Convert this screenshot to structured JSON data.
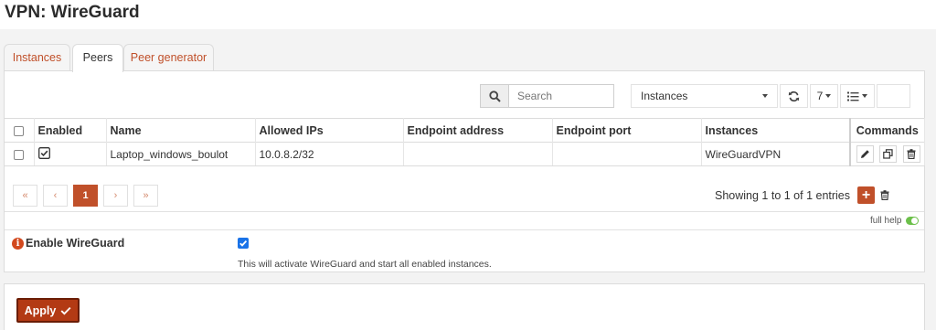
{
  "page": {
    "title": "VPN: WireGuard"
  },
  "tabs": [
    {
      "label": "Instances",
      "active": false
    },
    {
      "label": "Peers",
      "active": true
    },
    {
      "label": "Peer generator",
      "active": false
    }
  ],
  "toolbar": {
    "search_placeholder": "Search",
    "instances_filter": "Instances",
    "page_size": "7"
  },
  "grid": {
    "columns": {
      "enabled": "Enabled",
      "name": "Name",
      "allowed_ips": "Allowed IPs",
      "endpoint_address": "Endpoint address",
      "endpoint_port": "Endpoint port",
      "instances": "Instances",
      "commands": "Commands"
    },
    "rows": [
      {
        "enabled": true,
        "name": "Laptop_windows_boulot",
        "allowed_ips": "10.0.8.2/32",
        "endpoint_address": "",
        "endpoint_port": "",
        "instances": "WireGuardVPN"
      }
    ]
  },
  "pagination": {
    "first": "«",
    "prev": "‹",
    "current": "1",
    "next": "›",
    "last": "»",
    "info": "Showing 1 to 1 of 1 entries"
  },
  "help": {
    "label": "full help"
  },
  "settings": {
    "enable_label": "Enable WireGuard",
    "enable_checked": true,
    "enable_help": "This will activate WireGuard and start all enabled instances."
  },
  "apply": {
    "label": "Apply"
  },
  "colors": {
    "accent": "#c0502a",
    "apply": "#b33a14",
    "checkbox": "#1a73e8",
    "toggle": "#6cc04a"
  }
}
